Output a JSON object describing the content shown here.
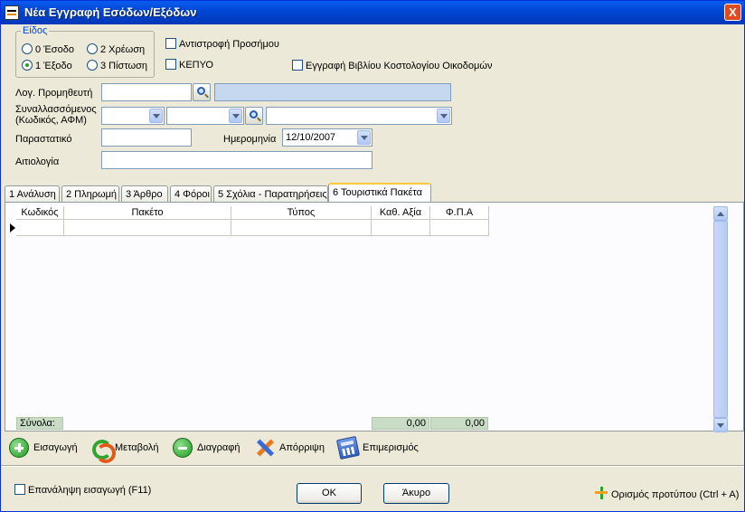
{
  "window": {
    "title": "Νέα Εγγραφή Εσόδων/Εξόδων",
    "close_label": "X"
  },
  "eidos": {
    "legend": "Είδος",
    "options": [
      {
        "label": "0 Έσοδο",
        "selected": false
      },
      {
        "label": "2 Χρέωση",
        "selected": false
      },
      {
        "label": "1 Έξοδο",
        "selected": true
      },
      {
        "label": "3 Πίστωση",
        "selected": false
      }
    ]
  },
  "checks": {
    "antistrofi": {
      "label": "Αντιστροφή Προσήμου",
      "checked": false
    },
    "kepyo": {
      "label": "ΚΕΠΥΟ",
      "checked": false
    },
    "vivlio": {
      "label": "Εγγραφή Βιβλίου Κοστολογίου Οικοδομών",
      "checked": false
    }
  },
  "form": {
    "log_label": "Λογ. Προμηθευτή",
    "log_value": "",
    "log_desc": "",
    "synal_label_1": "Συναλλασσόμενος",
    "synal_label_2": "(Κωδικός, ΑΦΜ)",
    "synal_code": "",
    "synal_afm": "",
    "synal_name": "",
    "parastatiko_label": "Παραστατικό",
    "parastatiko_value": "",
    "date_label": "Ημερομηνία",
    "date_value": "12/10/2007",
    "aitiologia_label": "Αιτιολογία",
    "aitiologia_value": ""
  },
  "tabs": [
    {
      "label": "1 Ανάλυση"
    },
    {
      "label": "2 Πληρωμή"
    },
    {
      "label": "3 Άρθρο"
    },
    {
      "label": "4 Φόροι"
    },
    {
      "label": "5 Σχόλια - Παρατηρήσεις"
    },
    {
      "label": "6 Τουριστικά Πακέτα"
    }
  ],
  "grid": {
    "columns": [
      "Κωδικός",
      "Πακέτο",
      "Τύπος",
      "Καθ. Αξία",
      "Φ.Π.Α"
    ],
    "totals_label": "Σύνολα:",
    "total_value": "0,00",
    "total_vat": "0,00"
  },
  "toolbar": {
    "add": "Εισαγωγή",
    "edit": "Μεταβολή",
    "delete": "Διαγραφή",
    "reject": "Απόρριψη",
    "allocate": "Επιμερισμός"
  },
  "footer": {
    "repeat_label": "Επανάληψη εισαγωγή (F11)",
    "ok": "OK",
    "cancel": "Άκυρο",
    "template": "Ορισμός προτύπου (Ctrl + A)"
  }
}
